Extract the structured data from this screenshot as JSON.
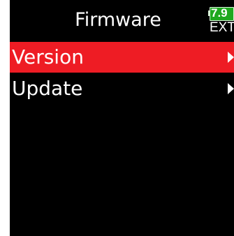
{
  "header": {
    "title": "Firmware"
  },
  "battery": {
    "value": "7.9",
    "source": "EXT",
    "color": "#1ea81e"
  },
  "menu": {
    "items": [
      {
        "label": "Version",
        "selected": true,
        "arrow_icon": "right-arrow-icon"
      },
      {
        "label": "Update",
        "selected": false,
        "arrow_icon": "right-arrow-icon"
      }
    ]
  },
  "colors": {
    "screen_background": "#000000",
    "selection": "#ee1c24",
    "text": "#ffffff"
  }
}
